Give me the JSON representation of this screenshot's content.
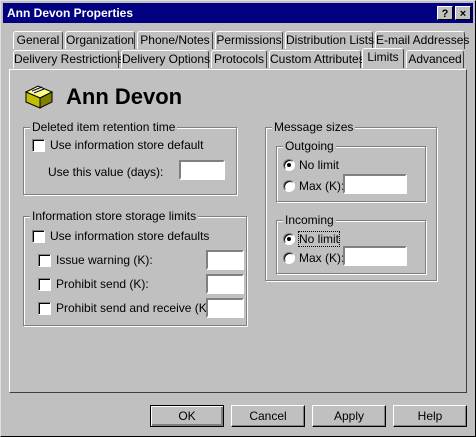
{
  "window": {
    "title": "Ann Devon Properties"
  },
  "tabs_row1": [
    "General",
    "Organization",
    "Phone/Notes",
    "Permissions",
    "Distribution Lists",
    "E-mail Addresses"
  ],
  "tabs_row2": [
    "Delivery Restrictions",
    "Delivery Options",
    "Protocols",
    "Custom Attributes",
    "Limits",
    "Advanced"
  ],
  "active_tab": "Limits",
  "header": {
    "name": "Ann Devon",
    "icon": "mailbox-icon"
  },
  "deleted_retention": {
    "title": "Deleted item retention time",
    "use_default_label": "Use information store default",
    "use_default_checked": false,
    "value_label": "Use this value (days):",
    "value": ""
  },
  "storage_limits": {
    "title": "Information store storage limits",
    "use_defaults_label": "Use information store defaults",
    "items": [
      {
        "label": "Issue warning (K):",
        "checked": false,
        "value": ""
      },
      {
        "label": "Prohibit send (K):",
        "checked": false,
        "value": ""
      },
      {
        "label": "Prohibit send and receive (K):",
        "checked": false,
        "value": ""
      }
    ]
  },
  "message_sizes": {
    "title": "Message sizes",
    "outgoing": {
      "title": "Outgoing",
      "no_limit_label": "No limit",
      "max_label": "Max (K):",
      "selected": "No limit",
      "max_value": ""
    },
    "incoming": {
      "title": "Incoming",
      "no_limit_label": "No limit",
      "max_label": "Max (K):",
      "selected": "No limit",
      "max_value": ""
    }
  },
  "buttons": {
    "ok": "OK",
    "cancel": "Cancel",
    "apply": "Apply",
    "help": "Help"
  }
}
